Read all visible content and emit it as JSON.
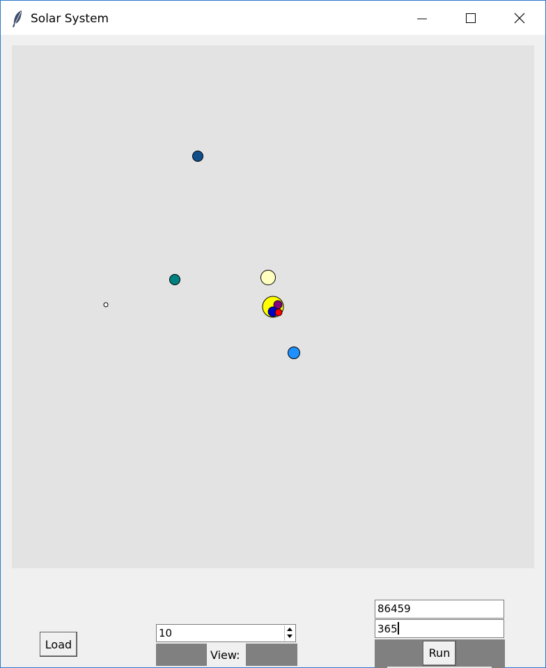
{
  "window": {
    "title": "Solar System",
    "icon": "feather-icon",
    "controls": [
      "minimize-icon",
      "maximize-icon",
      "close-icon"
    ]
  },
  "canvas": {
    "background": "#e3e3e3",
    "bodies": [
      {
        "name": "sun",
        "color": "#ffff00"
      },
      {
        "name": "mercury",
        "color": "#ff0000"
      },
      {
        "name": "venus",
        "color": "#800080"
      },
      {
        "name": "earth",
        "color": "#0000cd"
      },
      {
        "name": "mars",
        "color": "#ff0000"
      },
      {
        "name": "jupiter",
        "color": "#ffffc0"
      },
      {
        "name": "saturn",
        "color": "#1e90ff"
      },
      {
        "name": "uranus",
        "color": "#008080"
      },
      {
        "name": "neptune",
        "color": "#104e8b"
      },
      {
        "name": "pluto",
        "color": "#ffffff"
      }
    ]
  },
  "controls": {
    "load_label": "Load",
    "spin_value": "10",
    "view_label": "View:",
    "timestep_value": "86459",
    "steps_value": "365",
    "run_label": "Run"
  }
}
